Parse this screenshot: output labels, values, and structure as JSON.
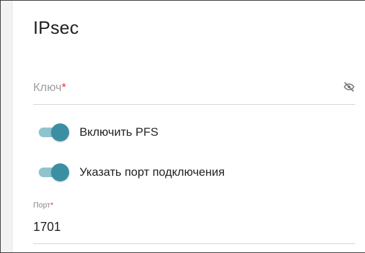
{
  "section": {
    "title": "IPsec"
  },
  "key_field": {
    "placeholder": "Ключ",
    "required_mark": "*",
    "visibility_icon": "eye-off-icon"
  },
  "toggles": [
    {
      "label": "Включить PFS",
      "checked": true
    },
    {
      "label": "Указать порт подключения",
      "checked": true
    }
  ],
  "port_field": {
    "label": "Порт",
    "required_mark": "*",
    "value": "1701"
  },
  "colors": {
    "toggle_thumb": "#3b8fa3",
    "toggle_track": "#8fc4cf",
    "required": "#e53935"
  }
}
